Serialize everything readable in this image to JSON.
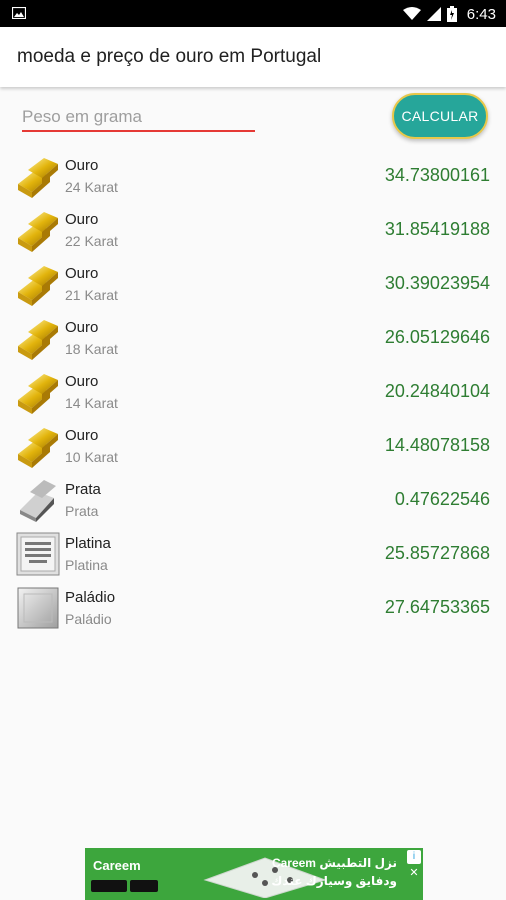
{
  "status_bar": {
    "time": "6:43",
    "icons": [
      "image-icon",
      "wifi-icon",
      "signal-icon",
      "battery-icon"
    ]
  },
  "app_bar": {
    "title": "moeda e preço de ouro em Portugal"
  },
  "form": {
    "placeholder": "Peso em grama",
    "value": "",
    "button_label": "CALCULAR"
  },
  "colors": {
    "accent_teal": "#26a69a",
    "price_green": "#2e7d32",
    "input_underline": "#e53935",
    "button_border": "#e8c84a"
  },
  "items": [
    {
      "name": "Ouro",
      "sub": "24 Karat",
      "price": "34.73800161",
      "icon": "gold-bar-icon"
    },
    {
      "name": "Ouro",
      "sub": "22 Karat",
      "price": "31.85419188",
      "icon": "gold-bar-icon"
    },
    {
      "name": "Ouro",
      "sub": "21 Karat",
      "price": "30.39023954",
      "icon": "gold-bar-icon"
    },
    {
      "name": "Ouro",
      "sub": "18 Karat",
      "price": "26.05129646",
      "icon": "gold-bar-icon"
    },
    {
      "name": "Ouro",
      "sub": "14 Karat",
      "price": "20.24840104",
      "icon": "gold-bar-icon"
    },
    {
      "name": "Ouro",
      "sub": "10 Karat",
      "price": "14.48078158",
      "icon": "gold-bar-icon"
    },
    {
      "name": "Prata",
      "sub": "Prata",
      "price": "0.47622546",
      "icon": "silver-bar-icon"
    },
    {
      "name": "Platina",
      "sub": "Platina",
      "price": "25.85727868",
      "icon": "platinum-bar-icon"
    },
    {
      "name": "Paládio",
      "sub": "Paládio",
      "price": "27.64753365",
      "icon": "palladium-bar-icon"
    }
  ],
  "ad": {
    "brand": "Careem",
    "ar_line1": "Careem نزل التطبيش",
    "ar_line2": "ودفايق وسيارك عندك"
  }
}
